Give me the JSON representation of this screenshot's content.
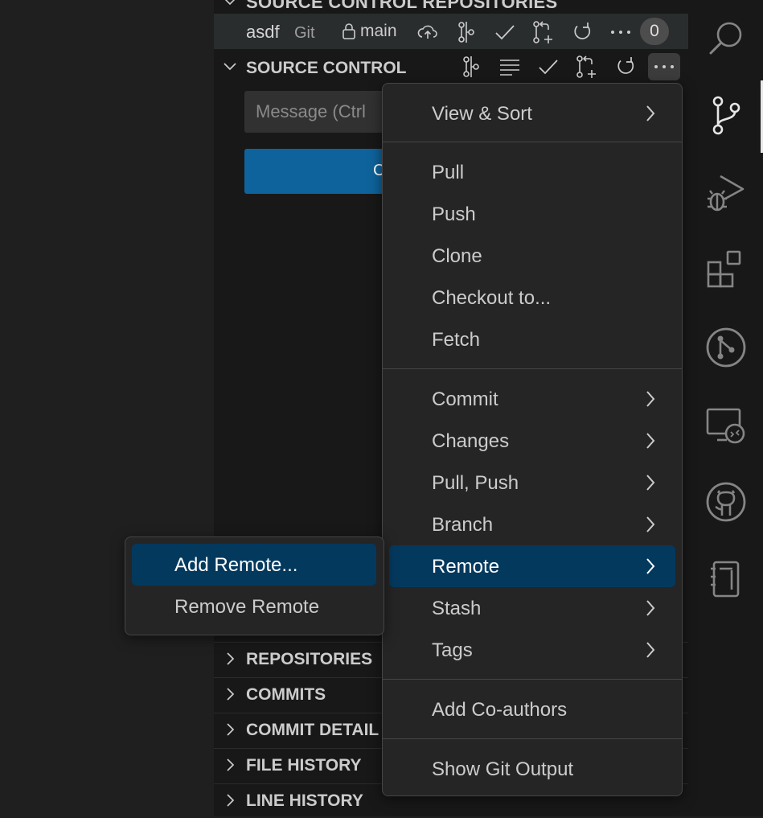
{
  "scm": {
    "repos_header": "SOURCE CONTROL REPOSITORIES",
    "repo": {
      "name": "asdf",
      "type": "Git",
      "branch": "main",
      "changes_count": "0"
    },
    "section_title": "SOURCE CONTROL",
    "message_placeholder": "Message (Ctrl",
    "commit_button_label": "C"
  },
  "sections": [
    "REPOSITORIES",
    "COMMITS",
    "COMMIT DETAIL",
    "FILE HISTORY",
    "LINE HISTORY"
  ],
  "menu": {
    "items": [
      {
        "label": "View & Sort"
      },
      {
        "label": "Pull"
      },
      {
        "label": "Push"
      },
      {
        "label": "Clone"
      },
      {
        "label": "Checkout to..."
      },
      {
        "label": "Fetch"
      },
      {
        "label": "Commit"
      },
      {
        "label": "Changes"
      },
      {
        "label": "Pull, Push"
      },
      {
        "label": "Branch"
      },
      {
        "label": "Remote"
      },
      {
        "label": "Stash"
      },
      {
        "label": "Tags"
      },
      {
        "label": "Add Co-authors"
      },
      {
        "label": "Show Git Output"
      }
    ]
  },
  "submenu": {
    "items": [
      {
        "label": "Add Remote..."
      },
      {
        "label": "Remove Remote"
      }
    ]
  },
  "activity_bar": {
    "icons": [
      "search-icon",
      "source-control-icon",
      "run-debug-icon",
      "extensions-icon",
      "git-graph-icon",
      "remote-explorer-icon",
      "github-icon",
      "notebook-icon"
    ],
    "active": "source-control-icon"
  },
  "colors": {
    "accent": "#0e639c",
    "menu_highlight": "#04395e",
    "menu_bg": "#252526",
    "sidebar_bg": "#181818"
  }
}
